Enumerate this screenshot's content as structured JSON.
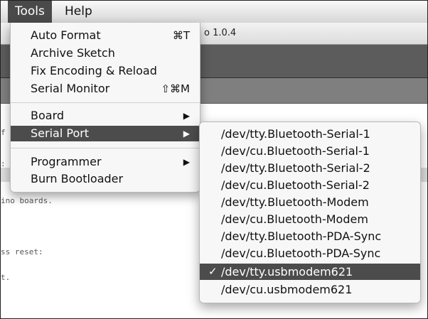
{
  "menubar": {
    "items": [
      {
        "label": "Tools"
      },
      {
        "label": "Help"
      }
    ]
  },
  "window": {
    "title_suffix": "o 1.0.4"
  },
  "editor": {
    "lines": [
      "f",
      ":",
      "ino boards.",
      "ss reset:",
      "t."
    ]
  },
  "tools_menu": {
    "items": [
      {
        "label": "Auto Format",
        "shortcut": "⌘T"
      },
      {
        "label": "Archive Sketch",
        "shortcut": ""
      },
      {
        "label": "Fix Encoding & Reload",
        "shortcut": ""
      },
      {
        "label": "Serial Monitor",
        "shortcut": "⇧⌘M"
      },
      {
        "label": "Board",
        "submenu_indicator": "▶"
      },
      {
        "label": "Serial Port",
        "submenu_indicator": "▶"
      },
      {
        "label": "Programmer",
        "submenu_indicator": "▶"
      },
      {
        "label": "Burn Bootloader",
        "shortcut": ""
      }
    ]
  },
  "serial_port_menu": {
    "items": [
      {
        "label": "/dev/tty.Bluetooth-Serial-1",
        "checked": false
      },
      {
        "label": "/dev/cu.Bluetooth-Serial-1",
        "checked": false
      },
      {
        "label": "/dev/tty.Bluetooth-Serial-2",
        "checked": false
      },
      {
        "label": "/dev/cu.Bluetooth-Serial-2",
        "checked": false
      },
      {
        "label": "/dev/tty.Bluetooth-Modem",
        "checked": false
      },
      {
        "label": "/dev/cu.Bluetooth-Modem",
        "checked": false
      },
      {
        "label": "/dev/tty.Bluetooth-PDA-Sync",
        "checked": false
      },
      {
        "label": "/dev/cu.Bluetooth-PDA-Sync",
        "checked": false
      },
      {
        "label": "/dev/tty.usbmodem621",
        "checked": true,
        "check_mark": "✓"
      },
      {
        "label": "/dev/cu.usbmodem621",
        "checked": false
      }
    ]
  }
}
